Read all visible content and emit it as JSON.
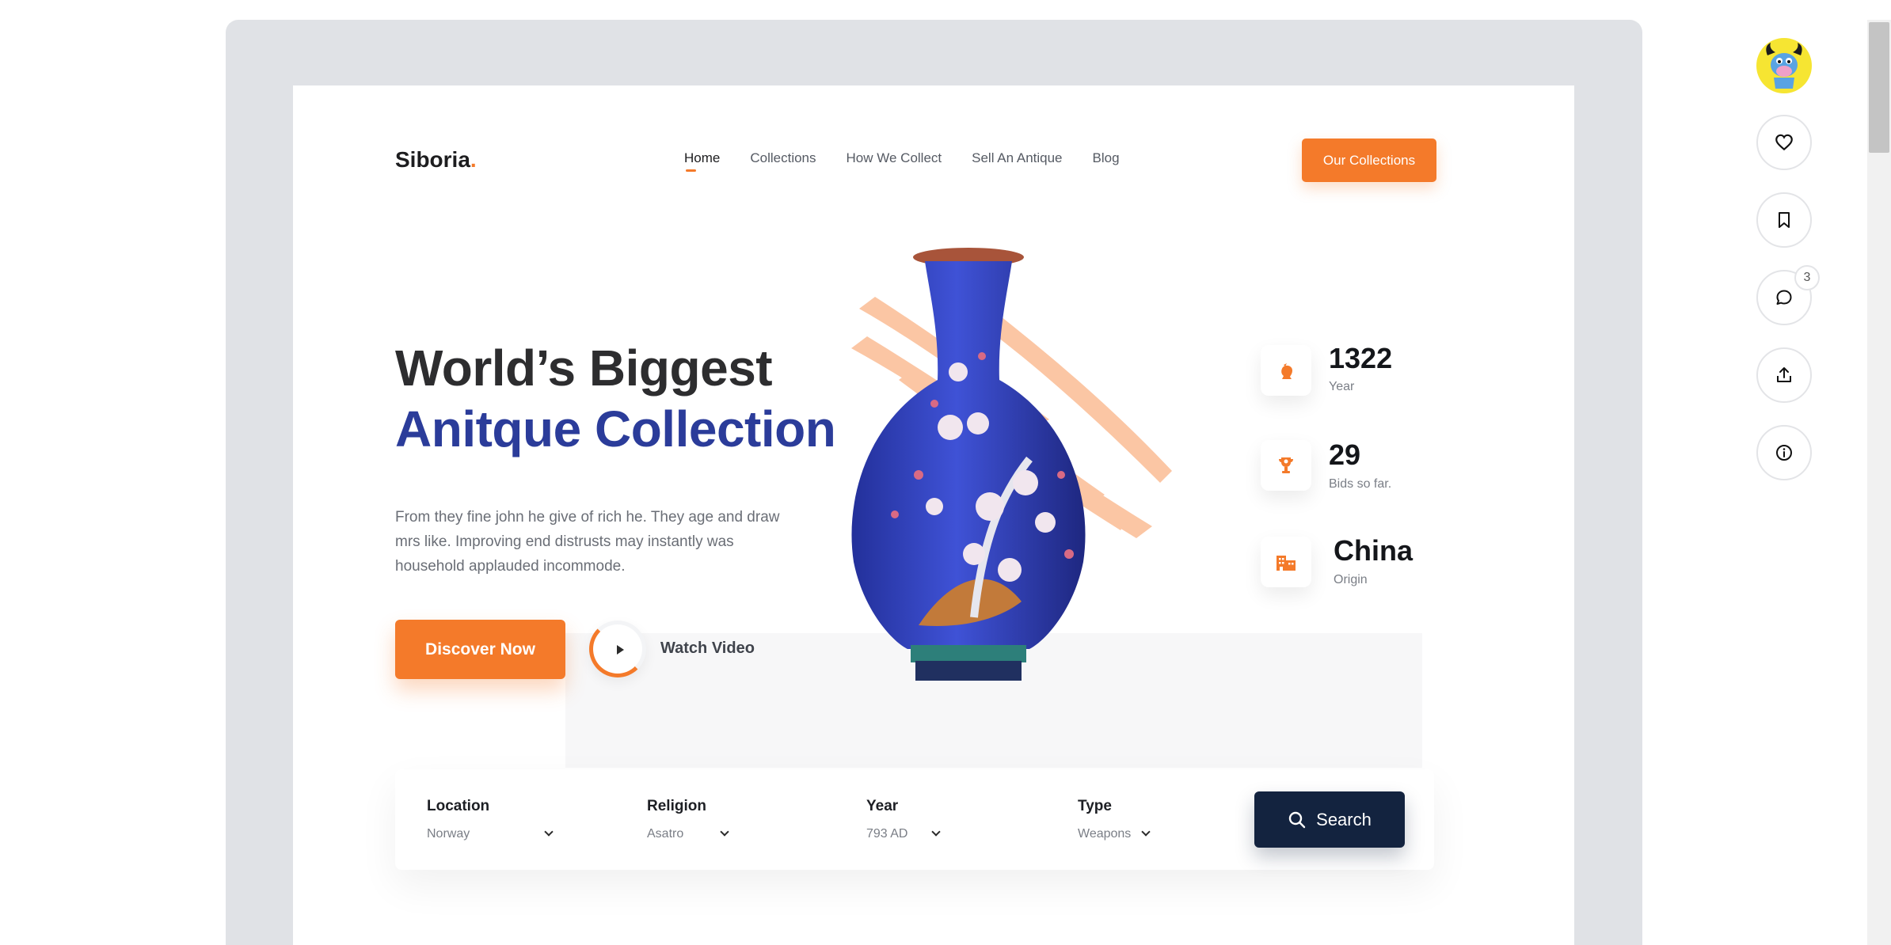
{
  "brand": {
    "name": "Siboria",
    "dot": ".",
    "accent": "#f47a2a",
    "primary": "#2b3c9a",
    "dark": "#13233f"
  },
  "nav": {
    "items": [
      "Home",
      "Collections",
      "How We Collect",
      "Sell An Antique",
      "Blog"
    ],
    "active": "Home",
    "cta": "Our Collections"
  },
  "hero": {
    "line1": "World’s Biggest",
    "line2": "Anitque Collection",
    "description": "From they fine john he give of rich he. They age and draw mrs like. Improving end distrusts may instantly was household applauded incommode.",
    "discover": "Discover Now",
    "watch": "Watch Video"
  },
  "stats": [
    {
      "value": "1322",
      "label": "Year",
      "icon": "bust-icon"
    },
    {
      "value": "29",
      "label": "Bids so far.",
      "icon": "trophy-icon"
    },
    {
      "value": "China",
      "label": "Origin",
      "icon": "building-icon"
    }
  ],
  "search": {
    "fields": [
      {
        "label": "Location",
        "value": "Norway"
      },
      {
        "label": "Religion",
        "value": "Asatro"
      },
      {
        "label": "Year",
        "value": "793 AD"
      },
      {
        "label": "Type",
        "value": "Weapons"
      }
    ],
    "button": "Search"
  },
  "sidebar": {
    "icons": [
      "avatar",
      "heart-icon",
      "bookmark-icon",
      "comment-icon",
      "share-icon",
      "info-icon"
    ],
    "comment_count": "3"
  }
}
